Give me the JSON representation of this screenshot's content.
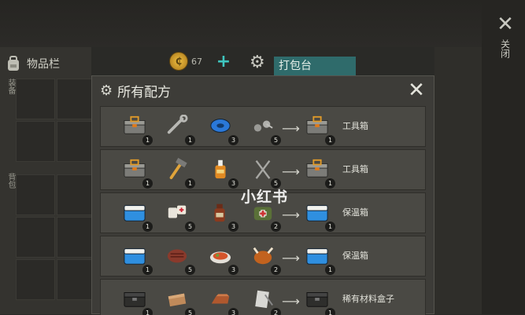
{
  "inventory": {
    "title": "物品栏",
    "side_label_1": "装备",
    "side_label_2": "背包"
  },
  "currency": {
    "amount": "67",
    "coin_symbol": "₵",
    "plus": "+"
  },
  "crafting_tab": {
    "label": "打包台"
  },
  "side_close": {
    "icon": "✕",
    "label": "关闭"
  },
  "modal": {
    "title": "所有配方",
    "close_icon": "✕",
    "gear_icon": "⚙"
  },
  "recipes": [
    {
      "ingredients": [
        {
          "icon": "toolbox",
          "count": "1"
        },
        {
          "icon": "wrench",
          "count": "1"
        },
        {
          "icon": "tape",
          "count": "3"
        },
        {
          "icon": "screws",
          "count": "5"
        }
      ],
      "result": {
        "icon": "toolbox",
        "count": "1",
        "name": "工具箱"
      }
    },
    {
      "ingredients": [
        {
          "icon": "toolbox",
          "count": "1"
        },
        {
          "icon": "hammer",
          "count": "1"
        },
        {
          "icon": "glue",
          "count": "3"
        },
        {
          "icon": "nails",
          "count": "5"
        }
      ],
      "result": {
        "icon": "toolbox",
        "count": "1",
        "name": "工具箱"
      }
    },
    {
      "ingredients": [
        {
          "icon": "cooler",
          "count": "1"
        },
        {
          "icon": "bandage",
          "count": "5"
        },
        {
          "icon": "bottle",
          "count": "3"
        },
        {
          "icon": "medkit",
          "count": "2"
        }
      ],
      "result": {
        "icon": "cooler",
        "count": "1",
        "name": "保温箱"
      }
    },
    {
      "ingredients": [
        {
          "icon": "cooler",
          "count": "1"
        },
        {
          "icon": "steak",
          "count": "5"
        },
        {
          "icon": "meal",
          "count": "3"
        },
        {
          "icon": "roast-chicken",
          "count": "2"
        }
      ],
      "result": {
        "icon": "cooler",
        "count": "1",
        "name": "保温箱"
      }
    },
    {
      "ingredients": [
        {
          "icon": "black-box",
          "count": "1"
        },
        {
          "icon": "plank",
          "count": "5"
        },
        {
          "icon": "copper-bar",
          "count": "3"
        },
        {
          "icon": "scrap",
          "count": "2"
        }
      ],
      "result": {
        "icon": "black-box",
        "count": "1",
        "name": "稀有材料盒子"
      }
    }
  ],
  "watermark": "小红书",
  "colors": {
    "accent_teal": "#3fc7c0",
    "modal_bg": "#3d3c38",
    "row_bg": "#4a4944"
  }
}
